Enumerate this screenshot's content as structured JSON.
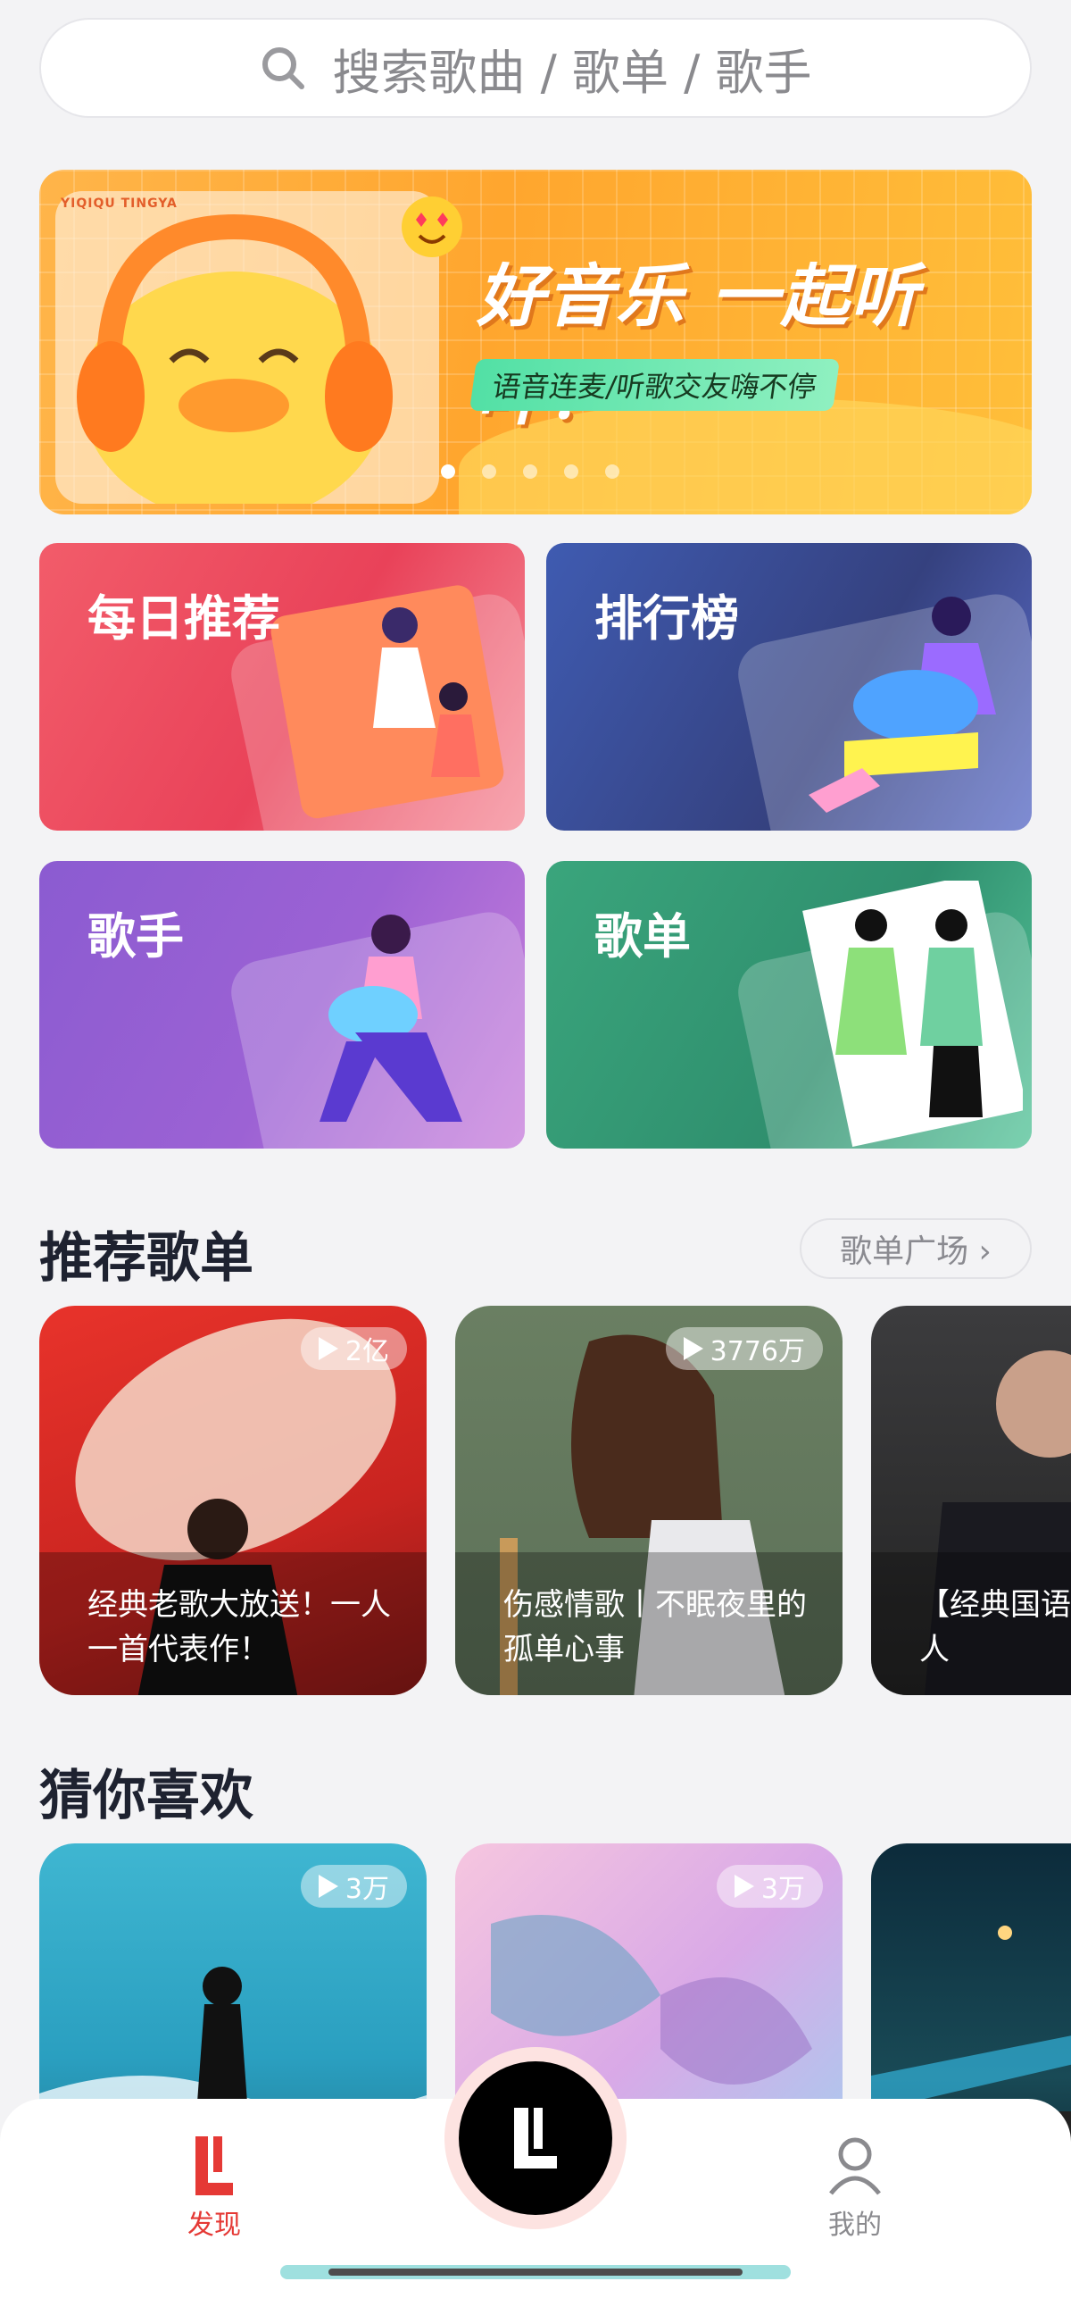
{
  "search": {
    "placeholder": "搜索歌曲 / 歌单 / 歌手"
  },
  "banner": {
    "tag": "YIQIQU TINGYA",
    "title": "好音乐 一起听吖！",
    "subtitle": "语音连麦/听歌交友嗨不停",
    "page_count": 5,
    "active_index": 0
  },
  "categories": [
    {
      "label": "每日推荐"
    },
    {
      "label": "排行榜"
    },
    {
      "label": "歌手"
    },
    {
      "label": "歌单"
    }
  ],
  "recommended": {
    "title": "推荐歌单",
    "more_label": "歌单广场 ›",
    "playlists": [
      {
        "plays": "2亿",
        "caption": "经典老歌大放送！一人一首代表作！"
      },
      {
        "plays": "3776万",
        "caption": "伤感情歌丨不眠夜里的孤单心事"
      },
      {
        "plays": "",
        "caption": "【经典国语】情怀老男人"
      }
    ]
  },
  "guess": {
    "title": "猜你喜欢",
    "playlists": [
      {
        "plays": "3万"
      },
      {
        "plays": "3万"
      },
      {
        "plays": ""
      }
    ]
  },
  "tabbar": {
    "discover": "发现",
    "mine": "我的"
  },
  "colors": {
    "accent": "#e53935",
    "background": "#f3f3f5"
  }
}
